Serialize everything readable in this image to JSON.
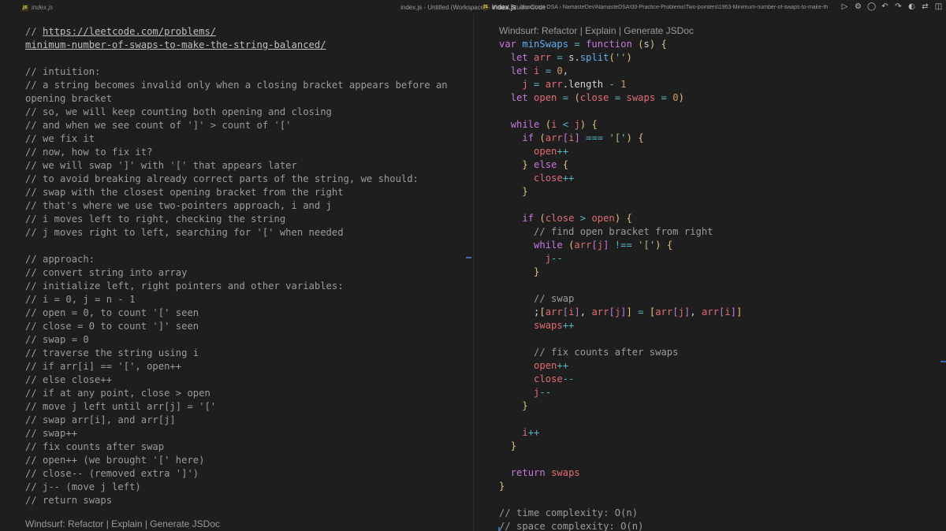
{
  "window": {
    "title": "index.js - Untitled (Workspace) - Visual Studio Code"
  },
  "left_tab": {
    "filename": "index.js",
    "icon": "js-file-icon"
  },
  "right_tab": {
    "filename": "index.js",
    "breadcrumb": "JavaScript-DSA › NamasteDev\\NamasteDSA\\00-Practice-Problems\\Two-pointers\\1963-Minimum-number-of-swaps-to-make-th",
    "icon": "js-file-icon"
  },
  "toolbar": {
    "icons": [
      "run-icon",
      "settings-icon",
      "open-changes-icon",
      "go-back-icon",
      "go-forward-icon",
      "copilot-icon",
      "compare-icon",
      "split-editor-icon",
      "more-actions-icon"
    ],
    "glyphs": [
      "▷",
      "⚙",
      "◯",
      "↶",
      "↷",
      "◐",
      "⇄",
      "◫",
      "…"
    ]
  },
  "left_editor": {
    "lines": [
      "// https://leetcode.com/problems/",
      "minimum-number-of-swaps-to-make-the-string-balanced/",
      "",
      "// intuition:",
      "// a string becomes invalid only when a closing bracket appears before an",
      "opening bracket",
      "// so, we will keep counting both opening and closing",
      "// and when we see count of ']' > count of '['",
      "// we fix it",
      "// now, how to fix it?",
      "// we will swap ']' with '[' that appears later",
      "// to avoid breaking already correct parts of the string, we should:",
      "// swap with the closest opening bracket from the right",
      "// that's where we use two-pointers approach, i and j",
      "// i moves left to right, checking the string",
      "// j moves right to left, searching for '[' when needed",
      "",
      "// approach:",
      "// convert string into array",
      "// initialize left, right pointers and other variables:",
      "// i = 0, j = n - 1",
      "// open = 0, to count '[' seen",
      "// close = 0 to count ']' seen",
      "// swap = 0",
      "// traverse the string using i",
      "// if arr[i] == '[', open++",
      "// else close++",
      "// if at any point, close > open",
      "// move j left until arr[j] = '['",
      "// swap arr[i], and arr[j]",
      "// swap++",
      "// fix counts after swap",
      "// open++ (we brought '[' here)",
      "// close-- (removed extra ']')",
      "// j-- (move j left)",
      "// return swaps"
    ],
    "codelens": "Windsurf: Refactor | Explain | Generate JSDoc"
  },
  "right_editor": {
    "codelens": "Windsurf: Refactor | Explain | Generate JSDoc",
    "lines": [
      "var minSwaps = function (s) {",
      "  let arr = s.split('')",
      "  let i = 0,",
      "    j = arr.length - 1",
      "  let open = (close = swaps = 0)",
      "",
      "  while (i < j) {",
      "    if (arr[i] === '[') {",
      "      open++",
      "    } else {",
      "      close++",
      "    }",
      "",
      "    if (close > open) {",
      "      // find open bracket from right",
      "      while (arr[j] !== '[') {",
      "        j--",
      "      }",
      "",
      "      // swap",
      "      ;[arr[i], arr[j]] = [arr[j], arr[i]]",
      "      swaps++",
      "",
      "      // fix counts after swaps",
      "      open++",
      "      close--",
      "      j--",
      "    }",
      "",
      "    i++",
      "  }",
      "",
      "  return swaps",
      "}",
      "",
      "// time complexity: O(n)",
      "// space complexity: O(n)"
    ]
  },
  "colors": {
    "background": "#1e1e1e",
    "comment": "#9b9b9b",
    "keyword": "#c678dd",
    "function": "#61afef",
    "variable": "#e06c75",
    "string": "#98c379",
    "number": "#d19a66",
    "operator": "#56b6c2",
    "accent": "#3b6bb5"
  }
}
